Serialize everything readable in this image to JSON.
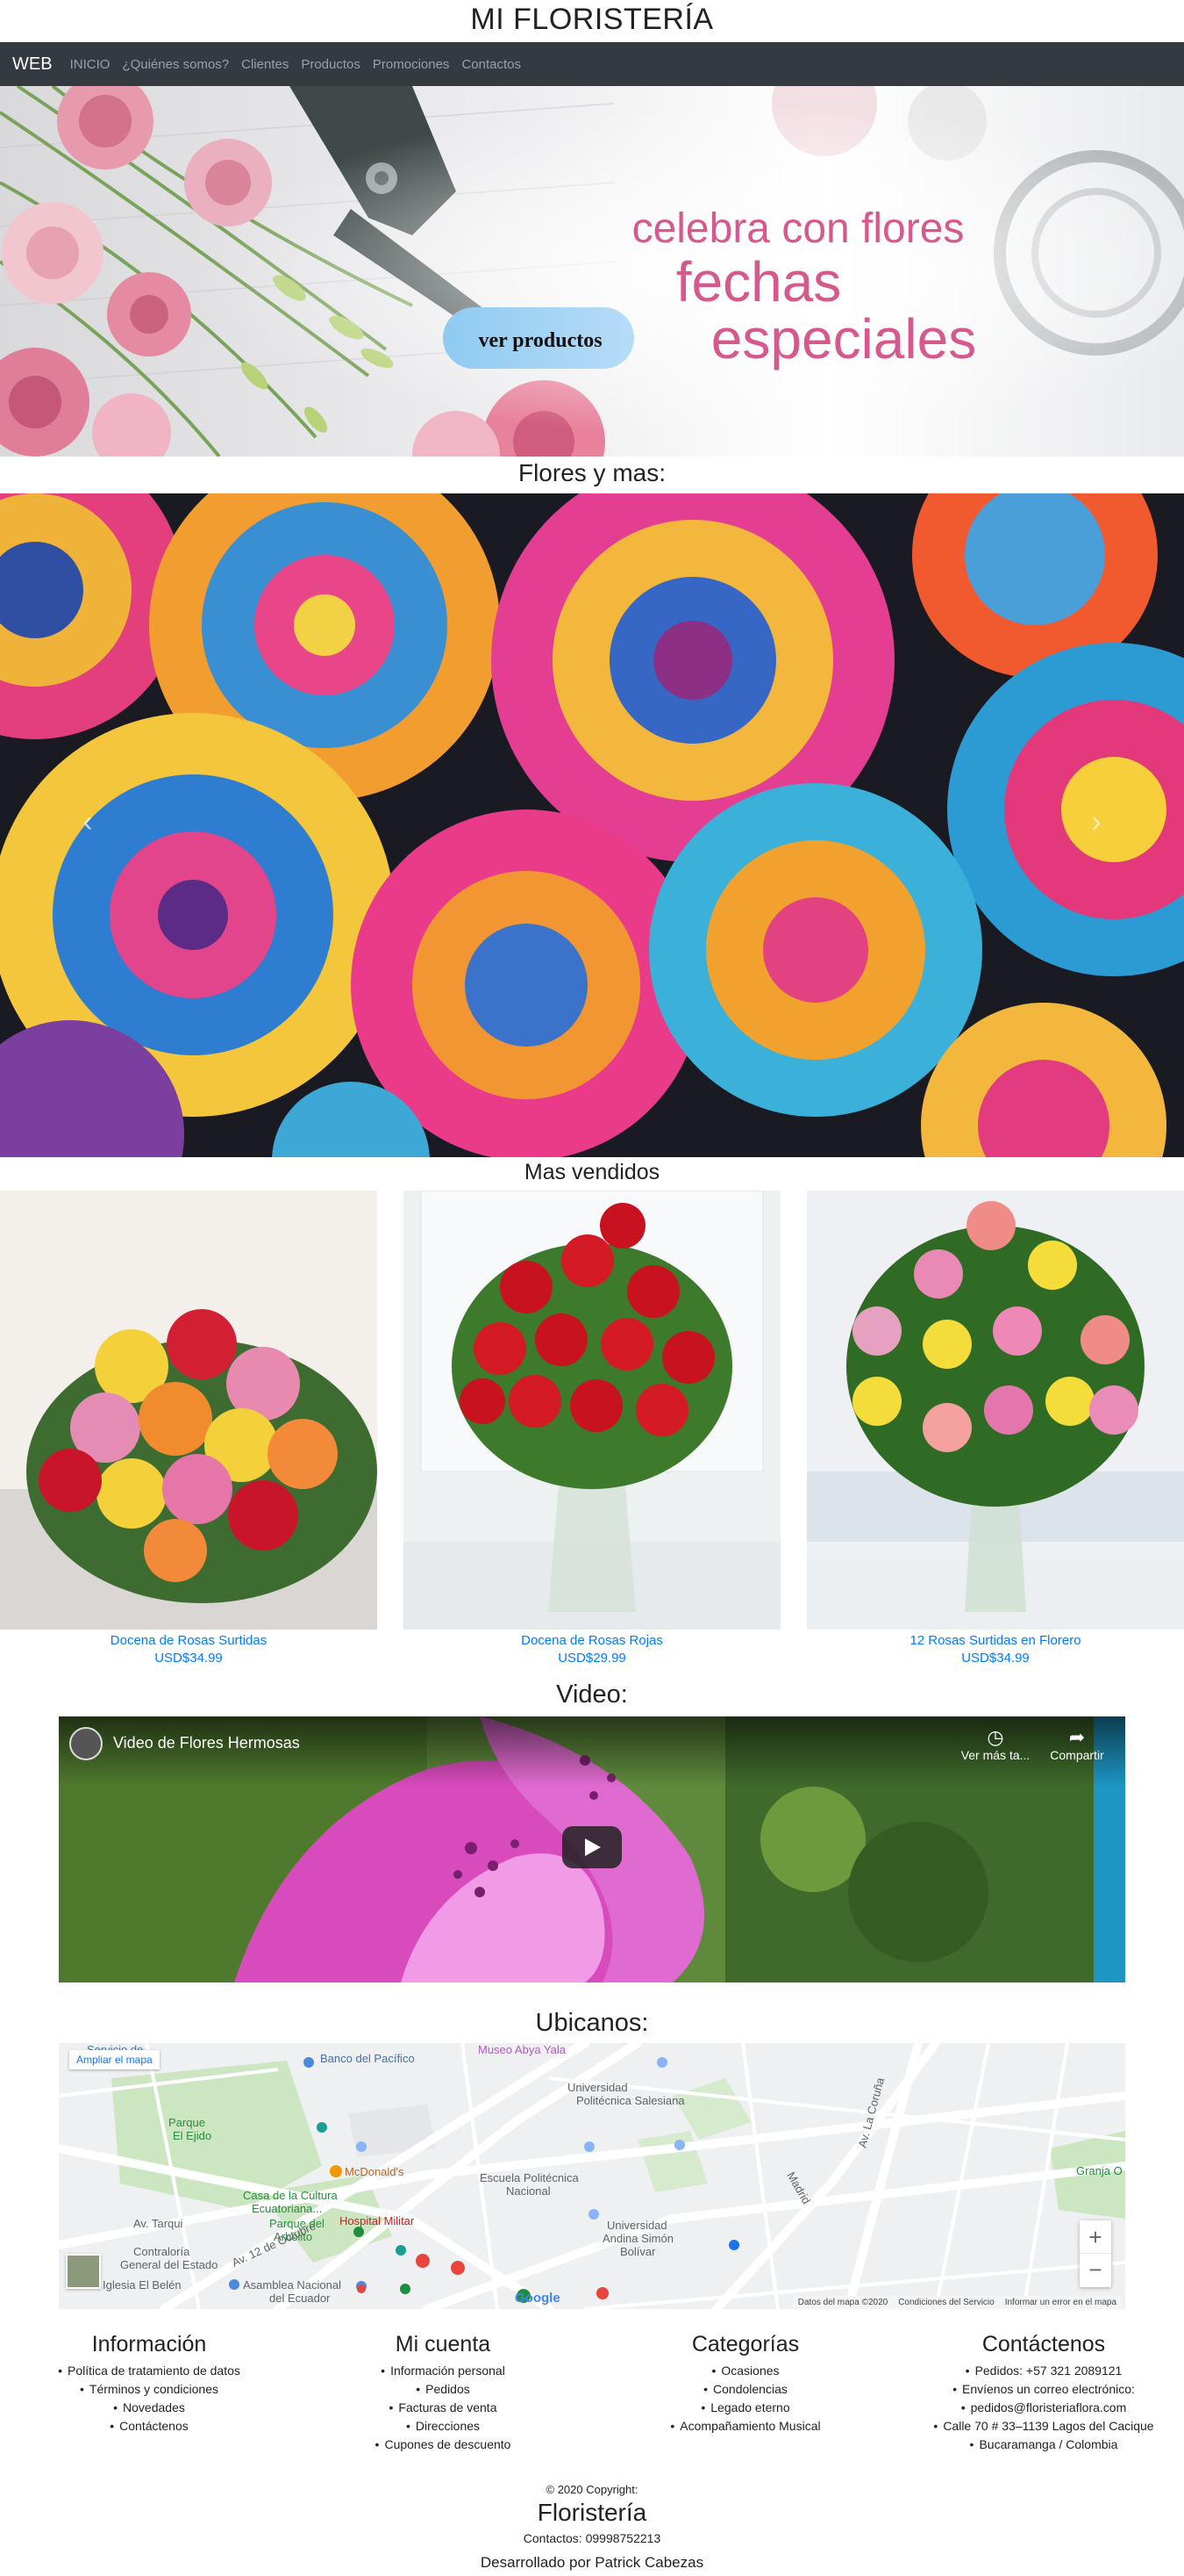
{
  "site": {
    "title": "MI FLORISTERÍA"
  },
  "nav": {
    "brand": "WEB",
    "items": [
      "INICIO",
      "¿Quiénes somos?",
      "Clientes",
      "Productos",
      "Promociones",
      "Contactos"
    ]
  },
  "hero": {
    "line1": "celebra con flores",
    "line2": "fechas",
    "line3": "especiales",
    "button": "ver productos"
  },
  "sections": {
    "flowers": "Flores y mas:",
    "best_sellers": "Mas vendidos",
    "video": "Video:",
    "location": "Ubicanos:"
  },
  "products": [
    {
      "name": "Docena de Rosas Surtidas",
      "price": "USD$34.99"
    },
    {
      "name": "Docena de Rosas Rojas",
      "price": "USD$29.99"
    },
    {
      "name": "12 Rosas Surtidas en Florero",
      "price": "USD$34.99"
    }
  ],
  "video": {
    "title": "Video de Flores Hermosas",
    "watch_later": "Ver más ta...",
    "share": "Compartir"
  },
  "map": {
    "enlarge": "Ampliar el mapa",
    "labels": [
      "Servicio de",
      "Banco del Pacífico",
      "Museo Abya Yala",
      "McDonald's",
      "Universidad Politécnica Salesiana",
      "Parque El Ejido",
      "Casa de la Cultura Ecuatoriana...",
      "Escuela Politécnica Nacional",
      "Parque del Arbolito",
      "Contraloría General del Estado",
      "Hospital Militar",
      "Universidad Andina Simón Bolívar",
      "Asamblea Nacional del Ecuador",
      "Iglesia El Belén",
      "Granja O",
      "Av. Tarqui",
      "Av. 12 de Octubre",
      "Madrid",
      "Av. La Coruña"
    ],
    "footer_data": "Datos del mapa ©2020",
    "footer_terms": "Condiciones del Servicio",
    "footer_report": "Informar un error en el mapa",
    "google": "Google"
  },
  "footer": {
    "columns": [
      {
        "title": "Información",
        "items": [
          "Política de tratamiento de datos",
          "Términos y condiciones",
          "Novedades",
          "Contáctenos"
        ]
      },
      {
        "title": "Mi cuenta",
        "items": [
          "Información personal",
          "Pedidos",
          "Facturas de venta",
          "Direcciones",
          "Cupones de descuento"
        ]
      },
      {
        "title": "Categorías",
        "items": [
          "Ocasiones",
          "Condolencias",
          "Legado eterno",
          "Acompañamiento Musical"
        ]
      },
      {
        "title": "Contáctenos",
        "items": [
          "Pedidos: +57 321 2089121",
          "Envíenos un correo electrónico:",
          "pedidos@floristeriaflora.com",
          "Calle 70 # 33–1139 Lagos del Cacique",
          "Bucaramanga / Colombia"
        ]
      }
    ],
    "copyright": "© 2020 Copyright:",
    "brand": "Floristería",
    "contact": "Contactos: 09998752213",
    "credit": "Desarrollado por Patrick Cabezas"
  }
}
